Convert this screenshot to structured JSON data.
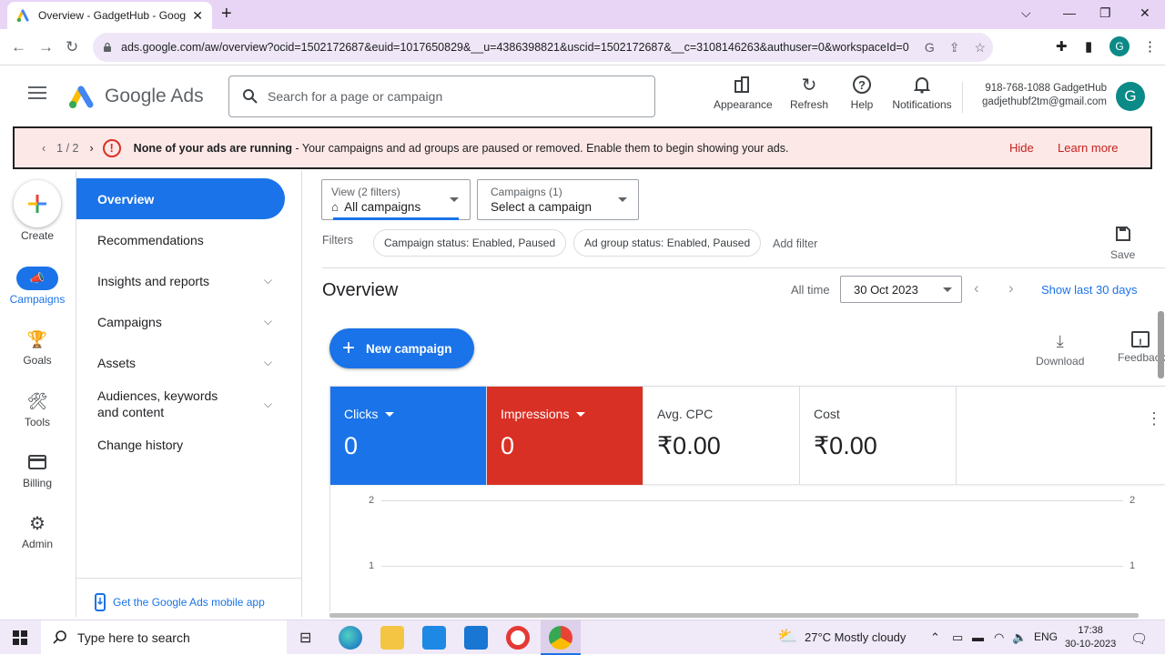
{
  "browser": {
    "tab_title": "Overview - GadgetHub - Google",
    "url": "ads.google.com/aw/overview?ocid=1502172687&euid=1017650829&__u=4386398821&uscid=1502172687&__c=3108146263&authuser=0&workspaceId=0",
    "profile_initial": "G"
  },
  "header": {
    "app_name": "Google Ads",
    "search_placeholder": "Search for a page or campaign",
    "buttons": {
      "appearance": "Appearance",
      "refresh": "Refresh",
      "help": "Help",
      "notifications": "Notifications"
    },
    "account_line1": "918-768-1088 GadgetHub",
    "account_line2": "gadjethubf2tm@gmail.com",
    "avatar_initial": "G"
  },
  "banner": {
    "pager": "1 / 2",
    "bold_text": "None of your ads are running",
    "text": " - Your campaigns and ad groups are paused or removed. Enable them to begin showing your ads.",
    "hide": "Hide",
    "learn_more": "Learn more"
  },
  "rail": {
    "create": "Create",
    "campaigns": "Campaigns",
    "goals": "Goals",
    "tools": "Tools",
    "billing": "Billing",
    "admin": "Admin"
  },
  "sidenav": {
    "items": [
      {
        "label": "Overview"
      },
      {
        "label": "Recommendations"
      },
      {
        "label": "Insights and reports"
      },
      {
        "label": "Campaigns"
      },
      {
        "label": "Assets"
      },
      {
        "label": "Audiences, keywords and content"
      },
      {
        "label": "Change history"
      }
    ],
    "mobile_app": "Get the Google Ads mobile app"
  },
  "main": {
    "view_label": "View (2 filters)",
    "view_value": "All campaigns",
    "campaigns_label": "Campaigns (1)",
    "campaigns_value": "Select a campaign",
    "filters_label": "Filters",
    "chips": [
      "Campaign status: Enabled, Paused",
      "Ad group status: Enabled, Paused"
    ],
    "add_filter": "Add filter",
    "save": "Save",
    "title": "Overview",
    "all_time": "All time",
    "date": "30 Oct 2023",
    "show_last": "Show last 30 days",
    "new_campaign": "New campaign",
    "download": "Download",
    "feedback": "Feedback",
    "metrics": [
      {
        "label": "Clicks",
        "value": "0",
        "color": "#1a73e8"
      },
      {
        "label": "Impressions",
        "value": "0",
        "color": "#d93025"
      },
      {
        "label": "Avg. CPC",
        "value": "₹0.00"
      },
      {
        "label": "Cost",
        "value": "₹0.00"
      }
    ],
    "chart_ticks": [
      "2",
      "1"
    ]
  },
  "taskbar": {
    "search": "Type here to search",
    "weather": "27°C  Mostly cloudy",
    "lang": "ENG",
    "time": "17:38",
    "date": "30-10-2023"
  }
}
